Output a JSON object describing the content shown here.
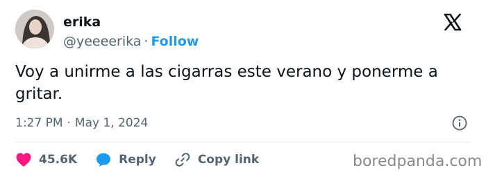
{
  "author": {
    "display_name": "erika",
    "handle": "@yeeeerika",
    "separator": "·",
    "follow_label": "Follow"
  },
  "tweet": {
    "text": "Voy a unirme a las cigarras este verano y ponerme a gritar.",
    "time": "1:27 PM",
    "separator": "·",
    "date": "May 1, 2024"
  },
  "actions": {
    "likes": "45.6K",
    "reply_label": "Reply",
    "copy_link_label": "Copy link"
  },
  "watermark": "boredpanda.com",
  "colors": {
    "accent": "#1d9bf0",
    "like": "#f91880",
    "secondary_text": "#536471"
  },
  "icons": [
    "x-logo-icon",
    "info-icon",
    "heart-icon",
    "reply-bubble-icon",
    "link-icon"
  ]
}
